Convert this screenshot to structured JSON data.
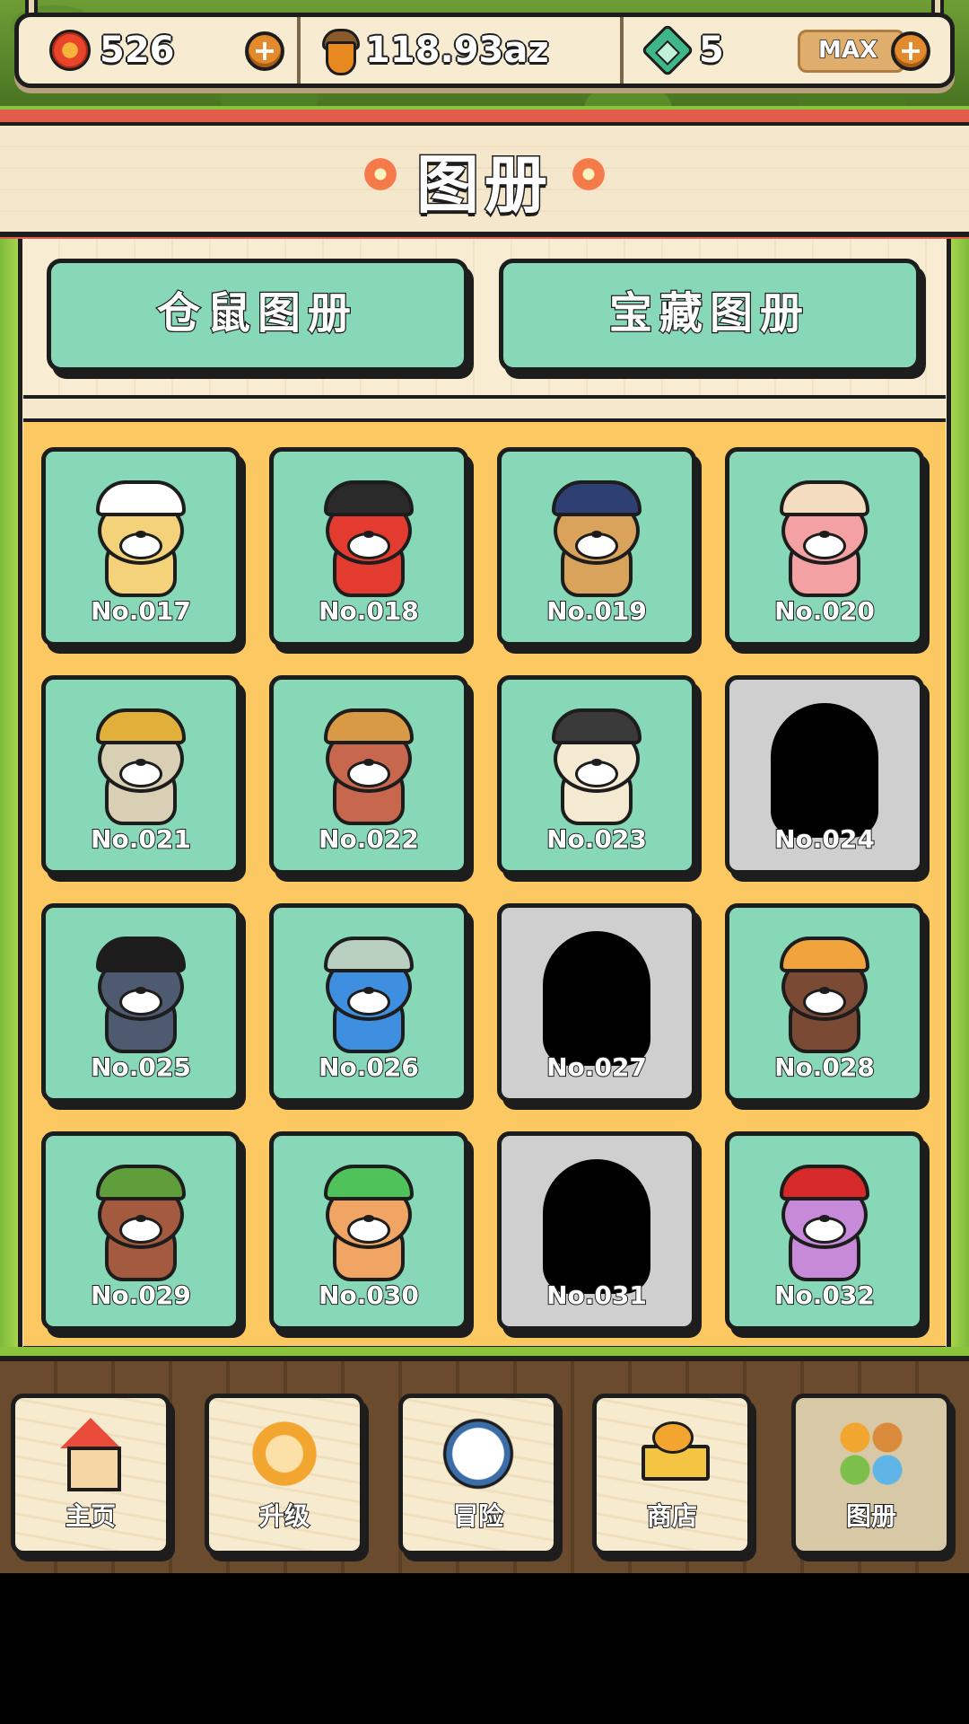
{
  "resources": {
    "flowers": "526",
    "acorns": "118.93az",
    "gems": "5",
    "max_label": "MAX",
    "plus_label": "+"
  },
  "title": "图册",
  "tabs": [
    {
      "label": "仓鼠图册"
    },
    {
      "label": "宝藏图册"
    }
  ],
  "collection": [
    {
      "num": "No.017",
      "locked": false,
      "color": "#f4d27a",
      "hat": "#ffffff"
    },
    {
      "num": "No.018",
      "locked": false,
      "color": "#e33b2f",
      "hat": "#2a2a2a"
    },
    {
      "num": "No.019",
      "locked": false,
      "color": "#d9a35b",
      "hat": "#2e3f73"
    },
    {
      "num": "No.020",
      "locked": false,
      "color": "#f3a1a3",
      "hat": "#f3dcc0"
    },
    {
      "num": "No.021",
      "locked": false,
      "color": "#d8cfb5",
      "hat": "#e0b03a"
    },
    {
      "num": "No.022",
      "locked": false,
      "color": "#c7674d",
      "hat": "#d89a45"
    },
    {
      "num": "No.023",
      "locked": false,
      "color": "#f4ead1",
      "hat": "#3a3a3a"
    },
    {
      "num": "No.024",
      "locked": true
    },
    {
      "num": "No.025",
      "locked": false,
      "color": "#4e5a70",
      "hat": "#1d1d1d"
    },
    {
      "num": "No.026",
      "locked": false,
      "color": "#3f8fe0",
      "hat": "#b9cfc0"
    },
    {
      "num": "No.027",
      "locked": true
    },
    {
      "num": "No.028",
      "locked": false,
      "color": "#7a4a35",
      "hat": "#f2a43c"
    },
    {
      "num": "No.029",
      "locked": false,
      "color": "#a45a3e",
      "hat": "#5f9e3a"
    },
    {
      "num": "No.030",
      "locked": false,
      "color": "#f0a565",
      "hat": "#4fc25a"
    },
    {
      "num": "No.031",
      "locked": true
    },
    {
      "num": "No.032",
      "locked": false,
      "color": "#c78ad8",
      "hat": "#d62a2a"
    }
  ],
  "nav": [
    {
      "label": "主页",
      "icon": "home-icon",
      "active": false
    },
    {
      "label": "升级",
      "icon": "lion-icon",
      "active": false
    },
    {
      "label": "冒险",
      "icon": "compass-icon",
      "active": false
    },
    {
      "label": "商店",
      "icon": "shop-cart-icon",
      "active": false
    },
    {
      "label": "图册",
      "icon": "album-icon",
      "active": true
    }
  ]
}
